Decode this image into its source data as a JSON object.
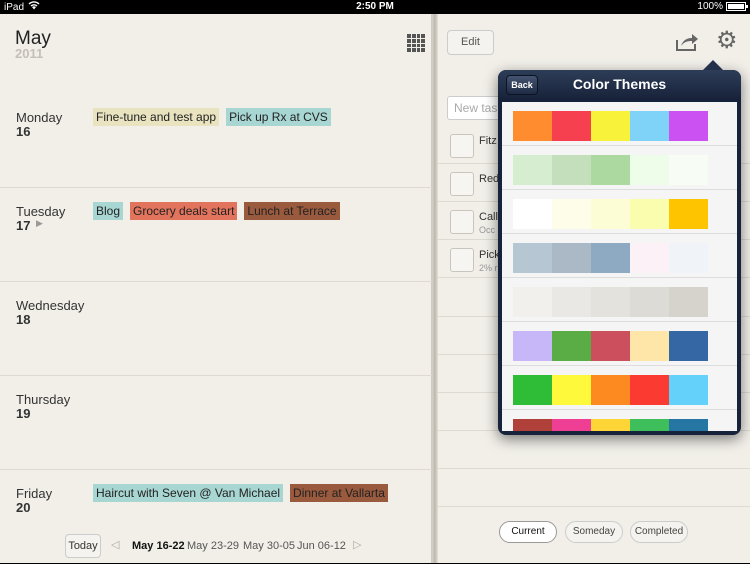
{
  "status": {
    "carrier": "iPad",
    "time": "2:50 PM",
    "battery": "100%"
  },
  "calendar": {
    "month": "May",
    "year": "2011",
    "days": [
      {
        "name": "Monday",
        "num": "16",
        "events": [
          {
            "label": "Fine-tune and test app",
            "color": "#e9e3c0"
          },
          {
            "label": "Pick up Rx at CVS",
            "color": "#a8d6d2"
          }
        ]
      },
      {
        "name": "Tuesday",
        "num": "17",
        "events": [
          {
            "label": "Blog",
            "color": "#a8d6d2"
          },
          {
            "label": "Grocery deals start",
            "color": "#e2745d"
          },
          {
            "label": "Lunch at Terrace",
            "color": "#9a5a3e"
          }
        ]
      },
      {
        "name": "Wednesday",
        "num": "18",
        "events": []
      },
      {
        "name": "Thursday",
        "num": "19",
        "events": []
      },
      {
        "name": "Friday",
        "num": "20",
        "events": [
          {
            "label": "Haircut with Seven @ Van Michael",
            "color": "#a8d6d2"
          },
          {
            "label": "Dinner at Vallarta",
            "color": "#9a5a3e"
          }
        ]
      }
    ],
    "nav": {
      "today": "Today",
      "weeks": [
        "May 16-22",
        "May 23-29",
        "May 30-05",
        "Jun 06-12"
      ]
    }
  },
  "tasks": {
    "edit": "Edit",
    "new_placeholder": "New task",
    "items": [
      {
        "title": "Fitz",
        "sub": ""
      },
      {
        "title": "Red",
        "sub": ""
      },
      {
        "title": "Call",
        "sub": "Occ"
      },
      {
        "title": "Pick",
        "sub": "2% r"
      }
    ],
    "filters": [
      "Current",
      "Someday",
      "Completed"
    ]
  },
  "popover": {
    "title": "Color Themes",
    "back": "Back",
    "themes": [
      [
        "#ff8c2e",
        "#f6404f",
        "#f8f33a",
        "#7fd2f8",
        "#cb51f2"
      ],
      [
        "#d6edd0",
        "#c3dfbb",
        "#acd99f",
        "#eefcea",
        "#f7fdf5"
      ],
      [
        "#ffffff",
        "#fdfdea",
        "#fcfdd5",
        "#fafcae",
        "#fec400"
      ],
      [
        "#b7c6d3",
        "#aab9c5",
        "#8eaac2",
        "#fcf1f7",
        "#f0f3f7"
      ],
      [
        "#f1f0ed",
        "#e9e8e4",
        "#e4e2dd",
        "#dddbd5",
        "#d5d3cc"
      ],
      [
        "#c7b7f9",
        "#5aac44",
        "#cb4f5d",
        "#fde6a7",
        "#3567a5"
      ],
      [
        "#2fbc36",
        "#fef93a",
        "#fd8a21",
        "#fb3a31",
        "#64d1fb"
      ],
      [
        "#b0403a",
        "#ee3f94",
        "#fdd537",
        "#3fbe5c",
        "#2676a3"
      ]
    ]
  }
}
